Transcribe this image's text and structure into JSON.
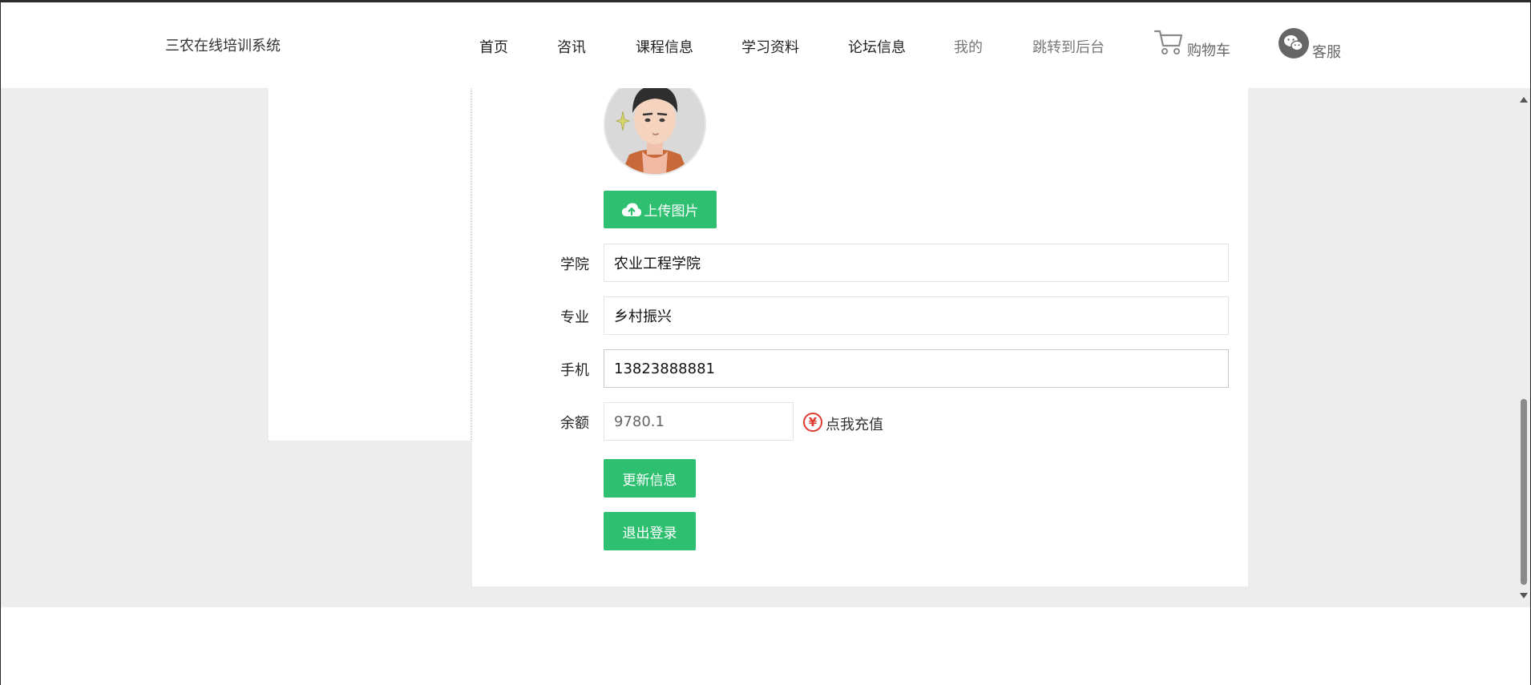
{
  "header": {
    "brand": "三农在线培训系统",
    "nav": {
      "home": "首页",
      "news": "咨讯",
      "courses": "课程信息",
      "materials": "学习资料",
      "forum": "论坛信息",
      "mine": "我的",
      "backend": "跳转到后台"
    },
    "cart": {
      "label": "购物车",
      "icon": "cart-icon"
    },
    "service": {
      "label": "客服",
      "icon": "wechat-icon"
    }
  },
  "profile": {
    "avatar_icon": "user-avatar",
    "upload_label": "上传图片",
    "fields": {
      "college": {
        "label": "学院",
        "value": "农业工程学院"
      },
      "major": {
        "label": "专业",
        "value": "乡村振兴"
      },
      "phone": {
        "label": "手机",
        "value": "13823888881"
      },
      "balance": {
        "label": "余额",
        "value": "9780.1"
      }
    },
    "recharge": {
      "symbol": "¥",
      "label": "点我充值"
    },
    "update_label": "更新信息",
    "logout_label": "退出登录"
  },
  "colors": {
    "accent": "#2fbf71",
    "recharge": "#e03a2f",
    "background": "#ededed"
  }
}
